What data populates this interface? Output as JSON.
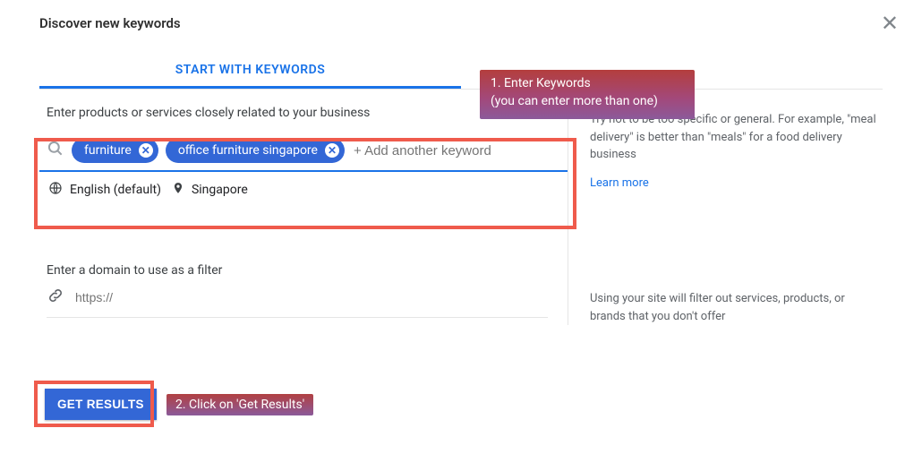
{
  "header": {
    "title": "Discover new keywords"
  },
  "tabs": {
    "active_label": "START WITH KEYWORDS"
  },
  "annotations": {
    "step1_line1": "1.   Enter Keywords",
    "step1_line2": "(you can enter more than one)",
    "step2": "2. Click on 'Get Results'"
  },
  "keywords": {
    "prompt": "Enter products or services closely related to your business",
    "chips": [
      "furniture",
      "office furniture singapore"
    ],
    "placeholder": "+ Add another keyword",
    "lang": "English (default)",
    "location": "Singapore"
  },
  "hint": {
    "text": "Try not to be too specific or general. For example, \"meal delivery\" is better than \"meals\" for a food delivery business",
    "learn_more": "Learn more"
  },
  "domain": {
    "label": "Enter a domain to use as a filter",
    "placeholder": "https://",
    "hint": "Using your site will filter out services, products, or brands that you don't offer"
  },
  "cta": {
    "label": "GET RESULTS"
  }
}
